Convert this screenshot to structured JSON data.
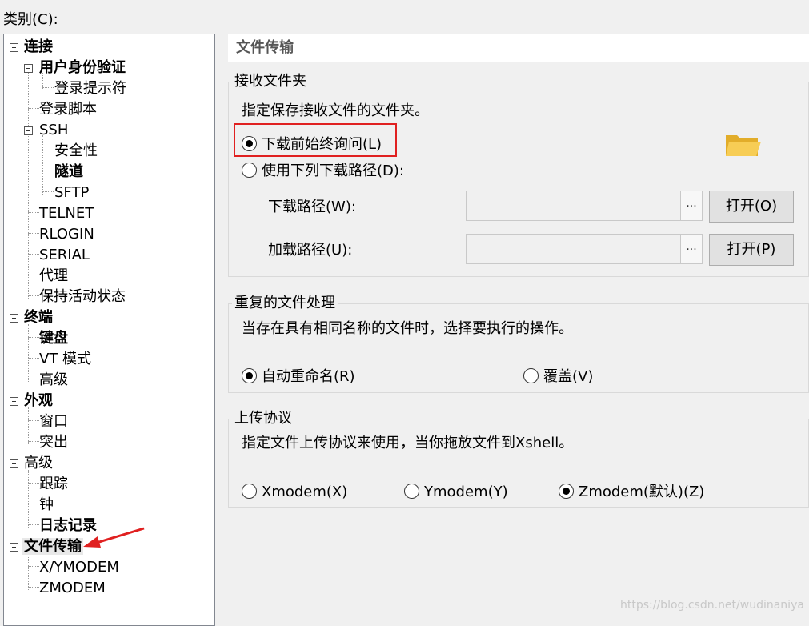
{
  "category_label": "类别(C):",
  "tree": {
    "items": [
      {
        "label": "连接",
        "bold": true
      },
      {
        "label": "用户身份验证",
        "bold": true
      },
      {
        "label": "登录提示符",
        "bold": false
      },
      {
        "label": "登录脚本",
        "bold": false
      },
      {
        "label": "SSH",
        "bold": false
      },
      {
        "label": "安全性",
        "bold": false
      },
      {
        "label": "隧道",
        "bold": true
      },
      {
        "label": "SFTP",
        "bold": false
      },
      {
        "label": "TELNET",
        "bold": false
      },
      {
        "label": "RLOGIN",
        "bold": false
      },
      {
        "label": "SERIAL",
        "bold": false
      },
      {
        "label": "代理",
        "bold": false
      },
      {
        "label": "保持活动状态",
        "bold": false
      },
      {
        "label": "终端",
        "bold": true
      },
      {
        "label": "键盘",
        "bold": true
      },
      {
        "label": "VT 模式",
        "bold": false
      },
      {
        "label": "高级",
        "bold": false
      },
      {
        "label": "外观",
        "bold": true
      },
      {
        "label": "窗口",
        "bold": false
      },
      {
        "label": "突出",
        "bold": false
      },
      {
        "label": "高级",
        "bold": false
      },
      {
        "label": "跟踪",
        "bold": false
      },
      {
        "label": "钟",
        "bold": false
      },
      {
        "label": "日志记录",
        "bold": true
      },
      {
        "label": "文件传输",
        "bold": true,
        "selected": true
      },
      {
        "label": "X/YMODEM",
        "bold": false
      },
      {
        "label": "ZMODEM",
        "bold": false
      }
    ]
  },
  "panel": {
    "title": "文件传输",
    "receive": {
      "group_title": "接收文件夹",
      "description": "指定保存接收文件的文件夹。",
      "option_ask": "下载前始终询问(L)",
      "option_path": "使用下列下载路径(D):",
      "selected": "ask",
      "download_label": "下载路径(W):",
      "download_value": "",
      "upload_label": "加载路径(U):",
      "upload_value": "",
      "browse_glyph": "...",
      "open_download_button": "打开(O)",
      "open_upload_button": "打开(P)"
    },
    "duplicate": {
      "group_title": "重复的文件处理",
      "description": "当存在具有相同名称的文件时，选择要执行的操作。",
      "option_rename": "自动重命名(R)",
      "option_overwrite": "覆盖(V)",
      "selected": "rename"
    },
    "upload": {
      "group_title": "上传协议",
      "description": "指定文件上传协议来使用，当你拖放文件到Xshell。",
      "option_xmodem": "Xmodem(X)",
      "option_ymodem": "Ymodem(Y)",
      "option_zmodem": "Zmodem(默认)(Z)",
      "selected": "zmodem"
    }
  },
  "colors": {
    "highlight_box": "#e02020",
    "arrow": "#e02020",
    "folder": "#f5c542"
  },
  "watermark": "https://blog.csdn.net/wudinaniya"
}
